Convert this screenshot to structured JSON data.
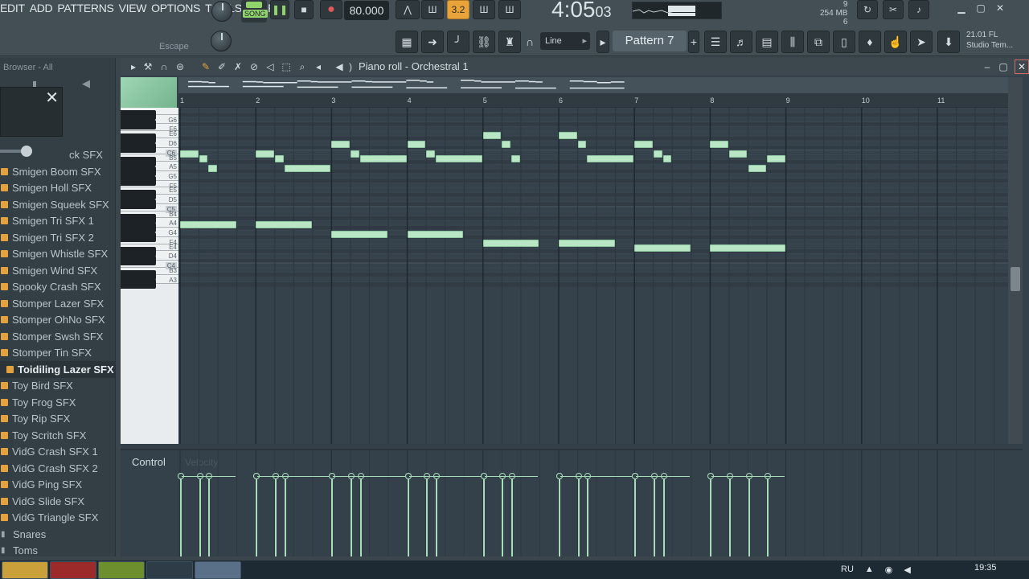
{
  "menu": [
    "EDIT",
    "ADD",
    "PATTERNS",
    "VIEW",
    "OPTIONS",
    "TOOLS",
    "HELP"
  ],
  "transport": {
    "song_label": "SONG",
    "tempo": "80.000",
    "time_main": "4:05",
    "time_sub": "03",
    "snap": "3.2",
    "hint": "Escape"
  },
  "status": {
    "mem_top": "9",
    "mem_label": "254 MB",
    "mem_bottom": "6"
  },
  "toolbar2": {
    "line_mode": "Line",
    "pattern": "Pattern 7",
    "studio_line1": "21.01  FL",
    "studio_line2": "Studio Tem..."
  },
  "browser": {
    "title": "Browser - All",
    "partial_label": "ck SFX",
    "items": [
      {
        "label": "Smigen Boom SFX",
        "type": "file"
      },
      {
        "label": "Smigen Holl SFX",
        "type": "file"
      },
      {
        "label": "Smigen Squeek SFX",
        "type": "file"
      },
      {
        "label": "Smigen Tri SFX 1",
        "type": "file"
      },
      {
        "label": "Smigen Tri SFX 2",
        "type": "file"
      },
      {
        "label": "Smigen Whistle SFX",
        "type": "file"
      },
      {
        "label": "Smigen Wind SFX",
        "type": "file"
      },
      {
        "label": "Spooky Crash SFX",
        "type": "file"
      },
      {
        "label": "Stomper Lazer SFX",
        "type": "file"
      },
      {
        "label": "Stomper OhNo SFX",
        "type": "file"
      },
      {
        "label": "Stomper Swsh SFX",
        "type": "file"
      },
      {
        "label": "Stomper Tin SFX",
        "type": "file"
      },
      {
        "label": "Toidiling Lazer SFX",
        "type": "file",
        "selected": true
      },
      {
        "label": "Toy Bird SFX",
        "type": "file"
      },
      {
        "label": "Toy Frog SFX",
        "type": "file"
      },
      {
        "label": "Toy Rip SFX",
        "type": "file"
      },
      {
        "label": "Toy Scritch SFX",
        "type": "file"
      },
      {
        "label": "VidG Crash SFX 1",
        "type": "file"
      },
      {
        "label": "VidG Crash SFX 2",
        "type": "file"
      },
      {
        "label": "VidG Ping SFX",
        "type": "file"
      },
      {
        "label": "VidG Slide SFX",
        "type": "file"
      },
      {
        "label": "VidG Triangle SFX",
        "type": "file"
      },
      {
        "label": "Snares",
        "type": "folder"
      },
      {
        "label": "Toms",
        "type": "folder"
      }
    ]
  },
  "piano_roll": {
    "title": "Piano roll - Orchestral 1",
    "bars": [
      "1",
      "2",
      "3",
      "4",
      "5",
      "6",
      "7",
      "8",
      "9",
      "10",
      "11"
    ],
    "key_labels": [
      "G6",
      "F6",
      "E6",
      "D6",
      "C6",
      "B5",
      "A5",
      "G5",
      "F5",
      "E5",
      "D5",
      "C5",
      "B4",
      "A4",
      "G4",
      "F4",
      "E4",
      "D4",
      "C4",
      "B3",
      "A3"
    ],
    "control_label": "Control",
    "control_target": "Velocity",
    "notes": [
      {
        "pitch": "C6",
        "start": 1.0,
        "len": 0.25
      },
      {
        "pitch": "B5",
        "start": 1.25,
        "len": 0.125
      },
      {
        "pitch": "A5",
        "start": 1.375,
        "len": 0.125
      },
      {
        "pitch": "A4",
        "start": 1.0,
        "len": 0.75
      },
      {
        "pitch": "C6",
        "start": 2.0,
        "len": 0.25
      },
      {
        "pitch": "B5",
        "start": 2.25,
        "len": 0.125
      },
      {
        "pitch": "A5",
        "start": 2.375,
        "len": 0.625
      },
      {
        "pitch": "A4",
        "start": 2.0,
        "len": 0.75
      },
      {
        "pitch": "D6",
        "start": 3.0,
        "len": 0.25
      },
      {
        "pitch": "C6",
        "start": 3.25,
        "len": 0.125
      },
      {
        "pitch": "B5",
        "start": 3.375,
        "len": 0.625
      },
      {
        "pitch": "G4",
        "start": 3.0,
        "len": 0.75
      },
      {
        "pitch": "D6",
        "start": 4.0,
        "len": 0.25
      },
      {
        "pitch": "C6",
        "start": 4.25,
        "len": 0.125
      },
      {
        "pitch": "B5",
        "start": 4.375,
        "len": 0.625
      },
      {
        "pitch": "G4",
        "start": 4.0,
        "len": 0.75
      },
      {
        "pitch": "E6",
        "start": 5.0,
        "len": 0.25
      },
      {
        "pitch": "D6",
        "start": 5.25,
        "len": 0.125
      },
      {
        "pitch": "B5",
        "start": 5.375,
        "len": 0.125
      },
      {
        "pitch": "F4",
        "start": 5.0,
        "len": 0.75
      },
      {
        "pitch": "E6",
        "start": 6.0,
        "len": 0.25
      },
      {
        "pitch": "D6",
        "start": 6.25,
        "len": 0.125
      },
      {
        "pitch": "B5",
        "start": 6.375,
        "len": 0.625
      },
      {
        "pitch": "F4",
        "start": 6.0,
        "len": 0.75
      },
      {
        "pitch": "D6",
        "start": 7.0,
        "len": 0.25
      },
      {
        "pitch": "C6",
        "start": 7.25,
        "len": 0.125
      },
      {
        "pitch": "B5",
        "start": 7.375,
        "len": 0.125
      },
      {
        "pitch": "E4",
        "start": 7.0,
        "len": 0.75
      },
      {
        "pitch": "D6",
        "start": 8.0,
        "len": 0.25
      },
      {
        "pitch": "C6",
        "start": 8.25,
        "len": 0.25
      },
      {
        "pitch": "A5",
        "start": 8.5,
        "len": 0.25
      },
      {
        "pitch": "B5",
        "start": 8.75,
        "len": 0.25
      },
      {
        "pitch": "E4",
        "start": 8.0,
        "len": 1.0
      }
    ]
  },
  "taskbar": {
    "lang": "RU",
    "clock": "19:35"
  },
  "colors": {
    "accent": "#e8a33a",
    "note": "#b9e7c6",
    "grid_bg": "#35414b"
  }
}
